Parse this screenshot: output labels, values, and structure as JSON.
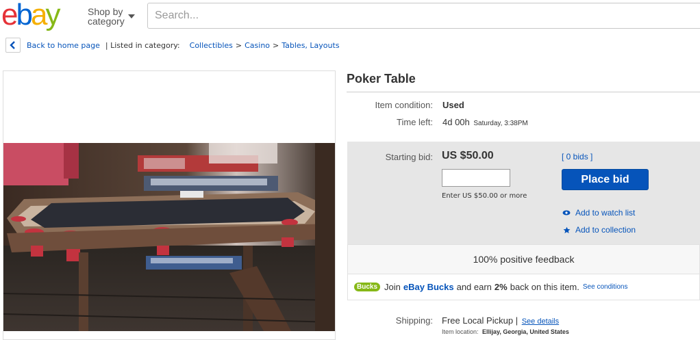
{
  "header": {
    "logo_letters": [
      "e",
      "b",
      "a",
      "y"
    ],
    "logo_colors": [
      "#e53238",
      "#0064d2",
      "#f5af02",
      "#86b817"
    ],
    "shop_by_line1": "Shop by",
    "shop_by_line2": "category",
    "search_placeholder": "Search..."
  },
  "breadcrumb": {
    "back_label": "Back to home page",
    "listed_label": "| Listed in category:",
    "items": [
      "Collectibles",
      "Casino",
      "Tables, Layouts"
    ],
    "separator": ">"
  },
  "item": {
    "title": "Poker Table",
    "condition_label": "Item condition:",
    "condition_value": "Used",
    "time_left_label": "Time left:",
    "time_left_value": "4d 00h",
    "time_left_detail": "Saturday, 3:38PM"
  },
  "bid": {
    "starting_bid_label": "Starting bid:",
    "starting_bid_value": "US $50.00",
    "bids_link": "[ 0 bids ]",
    "input_hint": "Enter US $50.00 or more",
    "place_bid_label": "Place bid",
    "watch_label": "Add to watch list",
    "collection_label": "Add to collection"
  },
  "feedback": {
    "text": "100% positive feedback"
  },
  "bucks": {
    "badge": "Bucks",
    "text_before": "Join",
    "link": "eBay Bucks",
    "text_mid": "and earn",
    "percent": "2%",
    "text_after": "back on this item.",
    "conditions_link": "See conditions"
  },
  "shipping": {
    "label": "Shipping:",
    "value": "Free Local Pickup",
    "separator": "|",
    "details_link": "See details",
    "location_label": "Item location:",
    "location_value": "Ellijay, Georgia, United States"
  },
  "colors": {
    "link": "#0654ba",
    "button": "#0654ba",
    "bid_panel_bg": "#e6e6e6"
  }
}
